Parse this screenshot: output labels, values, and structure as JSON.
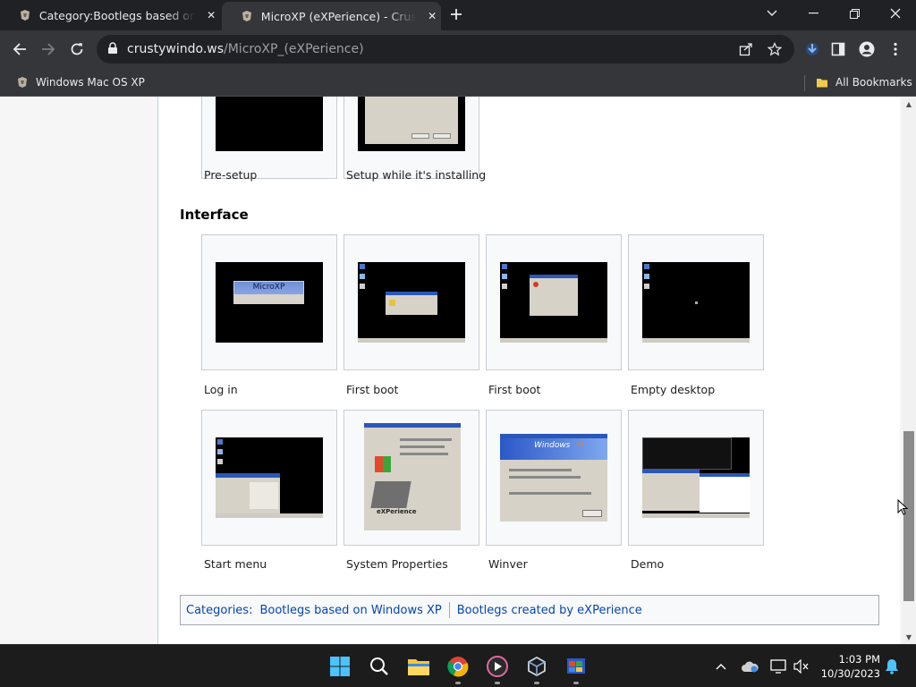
{
  "browser": {
    "tabs": [
      {
        "title": "Category:Bootlegs based on Windows XP - Crusty Windows",
        "active": false
      },
      {
        "title": "MicroXP (eXPerience) - Crusty Windows",
        "active": true
      }
    ],
    "url_domain": "crustywindo.ws",
    "url_path": "/MicroXP_(eXPerience)",
    "bookmarks": {
      "left": "Windows Mac OS XP",
      "right": "All Bookmarks"
    }
  },
  "page": {
    "top_captions": [
      "Pre-setup",
      "Setup while it's installing"
    ],
    "section_title": "Interface",
    "gallery_row1": [
      "Log in",
      "First boot",
      "First boot",
      "Empty desktop"
    ],
    "gallery_row2": [
      "Start menu",
      "System Properties",
      "Winver",
      "Demo"
    ],
    "thumb_texts": {
      "login_banner": "MicroXP",
      "windows_logo": "Windows",
      "xp_label": "XP",
      "experience": "eXPerience"
    },
    "categories": {
      "label": "Categories:",
      "items": [
        "Bootlegs based on Windows XP",
        "Bootlegs created by eXPerience"
      ]
    }
  },
  "taskbar": {
    "time": "1:03 PM",
    "date": "10/30/2023"
  },
  "colors": {
    "link": "#0645ad",
    "chrome_dark": "#202124",
    "chrome_toolbar": "#35363a"
  }
}
